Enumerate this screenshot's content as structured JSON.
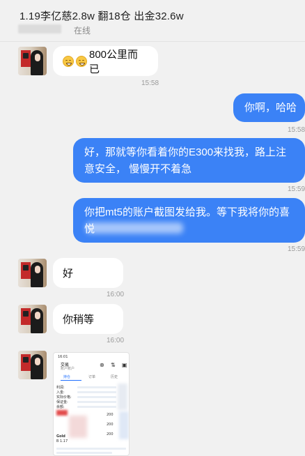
{
  "header": {
    "title": "1.19李亿慈2.8w 翻18仓 出金32.6w",
    "status": "在线"
  },
  "messages": [
    {
      "side": "left",
      "text": "800公里而已",
      "time": "15:58",
      "emoji": [
        "grimacing-emoji",
        "grimacing-emoji"
      ]
    },
    {
      "side": "right",
      "text": "你啊，哈哈",
      "time": "15:58"
    },
    {
      "side": "right",
      "text": "好，那就等你看着你的E300来找我，路上注意安全， 慢慢开不着急",
      "time": "15:59"
    },
    {
      "side": "right",
      "text": "你把mt5的账户截图发给我。等下我将你的喜悦",
      "time": "15:59"
    },
    {
      "side": "left",
      "text": "好",
      "time": "16:00"
    },
    {
      "side": "left",
      "text": "你稍等",
      "time": "16:00"
    },
    {
      "side": "left",
      "type": "image",
      "time": ""
    }
  ],
  "screenshot": {
    "status_time": "16:01",
    "account_title": "交易",
    "account_sub": "账户账户",
    "tab_positions": "持仓",
    "tab_orders": "订单",
    "tab_history": "历史",
    "rows": [
      "利润:",
      "入金:",
      "实际价格:",
      "保证金:",
      "余额:"
    ],
    "right_numbers": [
      "200",
      "200",
      "200"
    ],
    "bottom_labels": [
      "Gold",
      "B 1.17"
    ]
  },
  "colors": {
    "accent": "#3b82f6",
    "bubble_left": "#ffffff",
    "background": "#f1f1f1"
  }
}
